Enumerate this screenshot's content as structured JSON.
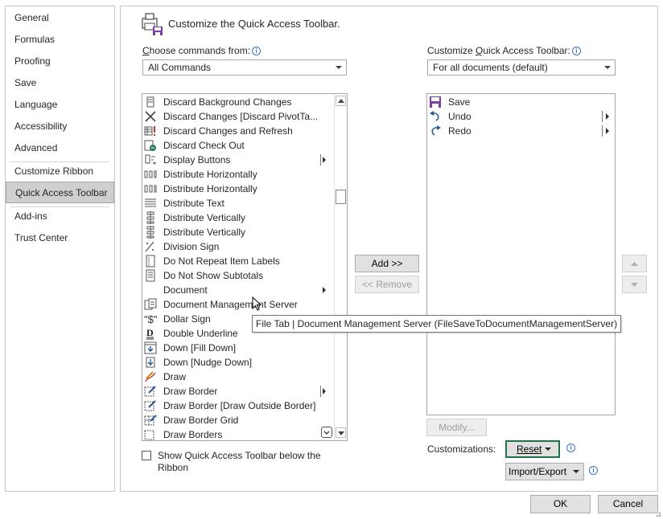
{
  "nav": {
    "items": [
      {
        "label": "General"
      },
      {
        "label": "Formulas"
      },
      {
        "label": "Proofing"
      },
      {
        "label": "Save"
      },
      {
        "label": "Language"
      },
      {
        "label": "Accessibility"
      },
      {
        "label": "Advanced"
      },
      {
        "label": "Customize Ribbon"
      },
      {
        "label": "Quick Access Toolbar",
        "active": true
      },
      {
        "label": "Add-ins"
      },
      {
        "label": "Trust Center"
      }
    ]
  },
  "header": {
    "title": "Customize the Quick Access Toolbar."
  },
  "left": {
    "choose_label_pre": "",
    "choose_label_u": "C",
    "choose_label_rest": "hoose commands from:",
    "choose_value": "All Commands",
    "commands": [
      {
        "label": "Discard Background Changes",
        "icon": "discard-bg-icon"
      },
      {
        "label": "Discard Changes [Discard PivotTa...",
        "icon": "x-icon"
      },
      {
        "label": "Discard Changes and Refresh",
        "icon": "refresh-warning-icon"
      },
      {
        "label": "Discard Check Out",
        "icon": "checkout-icon"
      },
      {
        "label": "Display Buttons",
        "icon": "display-buttons-icon",
        "submenu": true,
        "bar": true
      },
      {
        "label": "Distribute Horizontally",
        "icon": "distribute-h-icon"
      },
      {
        "label": "Distribute Horizontally",
        "icon": "distribute-h-icon"
      },
      {
        "label": "Distribute Text",
        "icon": "distribute-text-icon"
      },
      {
        "label": "Distribute Vertically",
        "icon": "distribute-v-icon"
      },
      {
        "label": "Distribute Vertically",
        "icon": "distribute-v-icon"
      },
      {
        "label": "Division Sign",
        "icon": "division-icon"
      },
      {
        "label": "Do Not Repeat Item Labels",
        "icon": "item-labels-icon"
      },
      {
        "label": "Do Not Show Subtotals",
        "icon": "subtotals-icon"
      },
      {
        "label": "Document",
        "icon": "",
        "submenu": true
      },
      {
        "label": "Document Management Server",
        "icon": "doc-server-icon"
      },
      {
        "label": "Dollar Sign",
        "icon": "dollar-icon"
      },
      {
        "label": "Double Underline",
        "icon": "double-underline-icon"
      },
      {
        "label": "Down [Fill Down]",
        "icon": "fill-down-icon"
      },
      {
        "label": "Down [Nudge Down]",
        "icon": "nudge-down-icon"
      },
      {
        "label": "Draw",
        "icon": "draw-icon"
      },
      {
        "label": "Draw Border",
        "icon": "draw-border-icon",
        "submenu": true,
        "bar": true
      },
      {
        "label": "Draw Border [Draw Outside Border]",
        "icon": "draw-border-icon"
      },
      {
        "label": "Draw Border Grid",
        "icon": "draw-border-grid-icon"
      },
      {
        "label": "Draw Borders",
        "icon": "draw-borders-icon"
      }
    ]
  },
  "right": {
    "label_pre": "Customize ",
    "label_u": "Q",
    "label_rest": "uick Access Toolbar:",
    "value": "For all documents (default)",
    "items": [
      {
        "label": "Save",
        "icon": "save-icon"
      },
      {
        "label": "Undo",
        "icon": "undo-icon",
        "submenu": true
      },
      {
        "label": "Redo",
        "icon": "redo-icon",
        "submenu": true
      }
    ],
    "modify_label": "Modify..."
  },
  "buttons": {
    "add": "Add >>",
    "remove": "<< Remove",
    "reset": "Reset",
    "import_export": "Import/Export",
    "ok": "OK",
    "cancel": "Cancel"
  },
  "customizations_label": "Customizations:",
  "show_below_label": "Show Quick Access Toolbar below the Ribbon",
  "show_below_line1": "Show Quick Access Toolbar below the",
  "show_below_line2": "Ribbon",
  "tooltip": "File Tab | Document Management Server (FileSaveToDocumentManagementServer)",
  "colors": {
    "accent": "#217346",
    "info": "#3a6fc4",
    "save": "#7b3f9e",
    "undo": "#2b5797"
  }
}
